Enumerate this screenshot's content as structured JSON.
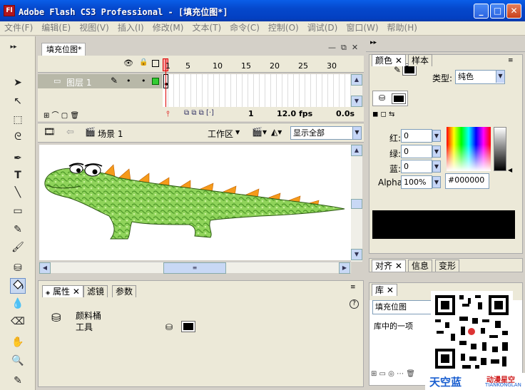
{
  "window": {
    "title": "Adobe Flash CS3 Professional - [填充位图*]",
    "app_icon": "Fl"
  },
  "menu": [
    "文件(F)",
    "编辑(E)",
    "视图(V)",
    "插入(I)",
    "修改(M)",
    "文本(T)",
    "命令(C)",
    "控制(O)",
    "调试(D)",
    "窗口(W)",
    "帮助(H)"
  ],
  "document": {
    "tab": "填充位图*"
  },
  "timeline": {
    "frame_numbers": [
      "1",
      "5",
      "10",
      "15",
      "20",
      "25",
      "30"
    ],
    "layer_name": "图层 1",
    "current_frame": "1",
    "fps": "12.0 fps",
    "time": "0.0s"
  },
  "editbar": {
    "scene": "场景 1",
    "workspace": "工作区",
    "zoom": "显示全部"
  },
  "properties": {
    "tabs": [
      "属性",
      "滤镜",
      "参数"
    ],
    "tool_name_line1": "颜料桶",
    "tool_name_line2": "工具"
  },
  "color_panel": {
    "tabs": [
      "颜色",
      "样本"
    ],
    "type_label": "类型:",
    "type_value": "纯色",
    "red_label": "红:",
    "red": "0",
    "green_label": "绿:",
    "green": "0",
    "blue_label": "蓝:",
    "blue": "0",
    "alpha_label": "Alpha:",
    "alpha": "100%",
    "hex": "#000000",
    "swatch_color": "#000000"
  },
  "align_panel": {
    "tabs": [
      "对齐",
      "信息",
      "变形"
    ]
  },
  "library": {
    "tab": "库",
    "doc": "填充位图",
    "count_text": "库中的一项"
  },
  "watermark": {
    "brand": "天空蓝",
    "sub1": "动漫星空",
    "sub2": "TIANKONGLAN"
  }
}
